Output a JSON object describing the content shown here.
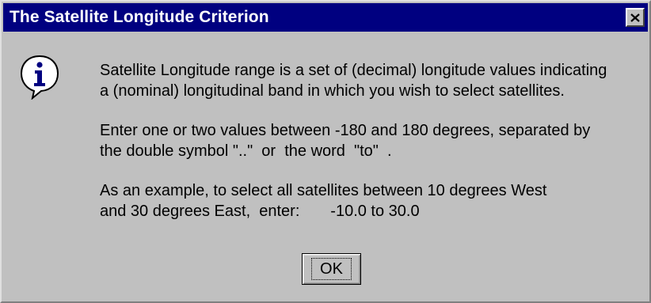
{
  "window": {
    "title": "The Satellite Longitude Criterion",
    "close_icon": "close-icon"
  },
  "icon": {
    "name": "info-icon",
    "glyph": "i"
  },
  "message": {
    "paragraphs": [
      {
        "lines": [
          "Satellite Longitude range is a set of (decimal) longitude values indicating",
          "a (nominal) longitudinal band in which you wish to select satellites."
        ]
      },
      {
        "lines": [
          "Enter one or two values between -180 and 180 degrees, separated by",
          "the double symbol \"..\"  or  the word  \"to\"  ."
        ]
      },
      {
        "lines": [
          "As an example, to select all satellites between 10 degrees West",
          "and 30 degrees East,  enter:       -10.0 to 30.0"
        ]
      }
    ]
  },
  "buttons": {
    "ok_label": "OK"
  },
  "colors": {
    "titlebar": "#000080",
    "dialog_face": "#c0c0c0",
    "title_text": "#ffffff"
  }
}
